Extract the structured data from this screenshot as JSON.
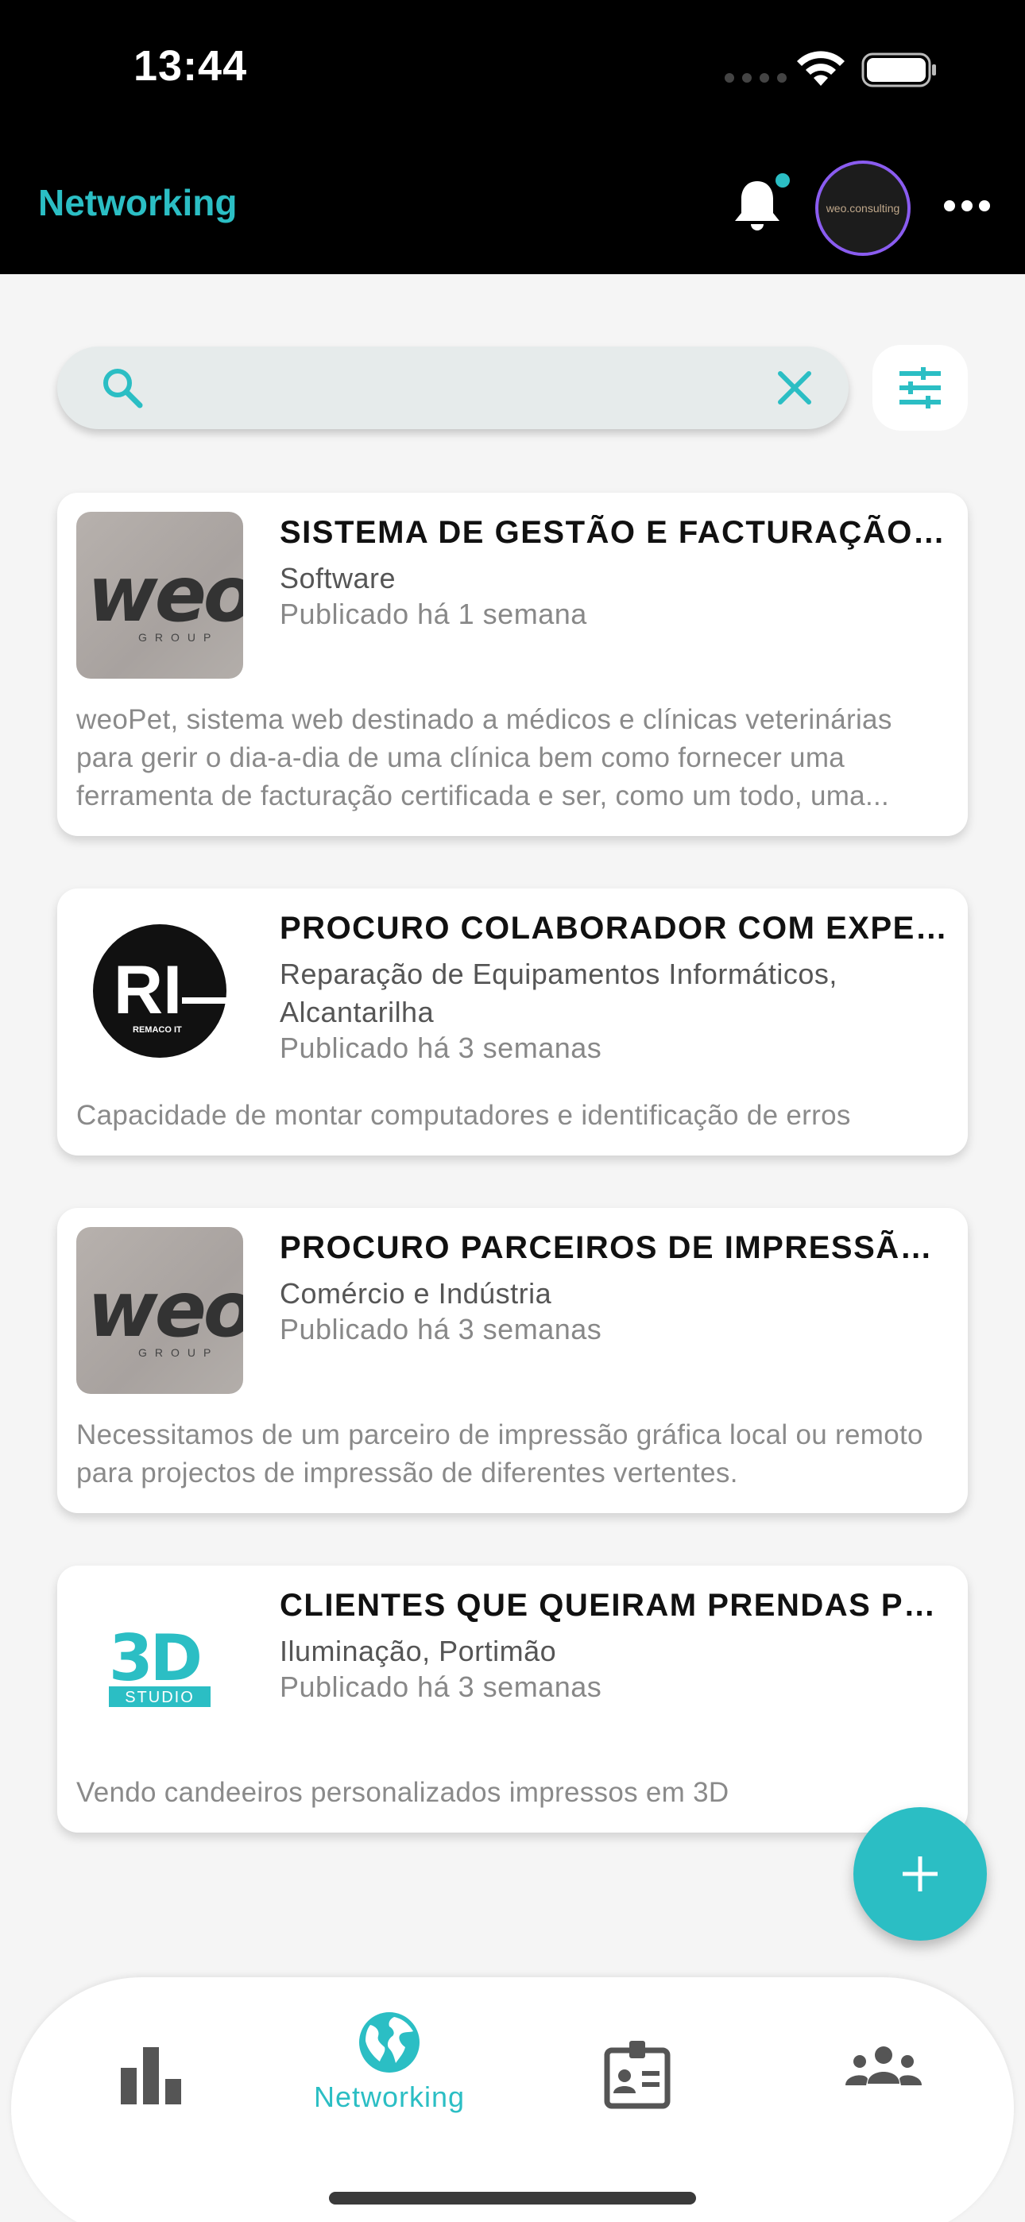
{
  "status_bar": {
    "time": "13:44"
  },
  "header": {
    "title": "Networking"
  },
  "avatar": {
    "text": "weo.consulting"
  },
  "search": {
    "value": "",
    "placeholder": ""
  },
  "cards": [
    {
      "title": "SISTEMA DE GESTÃO E FACTURAÇÃO V...",
      "category": "Software",
      "date": "Publicado há 1 semana",
      "description": "weoPet, sistema web destinado a médicos e clínicas veterinárias para gerir o dia-a-dia de uma clínica bem como fornecer uma ferramenta de facturação certificada e ser, como um todo, uma...",
      "logo": "weo-group-logo",
      "logo_text": "weo",
      "logo_sub": "GROUP"
    },
    {
      "title": "PROCURO COLABORADOR COM EXPERI...",
      "category": "Reparação de Equipamentos Informáticos, Alcantarilha",
      "date": "Publicado há 3 semanas",
      "description": "Capacidade de montar computadores e identificação de erros",
      "logo": "remaco-it-logo",
      "logo_text": "RI",
      "logo_sub": "REMACO IT"
    },
    {
      "title": "PROCURO PARCEIROS DE IMPRESSÃO ...",
      "category": "Comércio e Indústria",
      "date": "Publicado há 3 semanas",
      "description": "Necessitamos de um parceiro de impressão gráfica local ou remoto para projectos de impressão de diferentes vertentes.",
      "logo": "weo-group-logo",
      "logo_text": "weo",
      "logo_sub": "GROUP"
    },
    {
      "title": "CLIENTES QUE QUEIRAM PRENDAS PER...",
      "category": "Iluminação, Portimão",
      "date": "Publicado há 3 semanas",
      "description": "Vendo candeeiros personalizados impressos em 3D",
      "logo": "3d-studio-logo",
      "logo_text": "3D",
      "logo_sub": "STUDIO"
    }
  ],
  "bottom_nav": {
    "items": [
      {
        "name": "stats",
        "icon": "bar-chart-icon",
        "label": ""
      },
      {
        "name": "networking",
        "icon": "globe-icon",
        "label": "Networking",
        "active": true
      },
      {
        "name": "profile-card",
        "icon": "id-badge-icon",
        "label": ""
      },
      {
        "name": "community",
        "icon": "group-icon",
        "label": ""
      }
    ]
  },
  "colors": {
    "accent": "#2bbec4",
    "header_bg": "#000000",
    "page_bg": "#f5f5f5"
  }
}
